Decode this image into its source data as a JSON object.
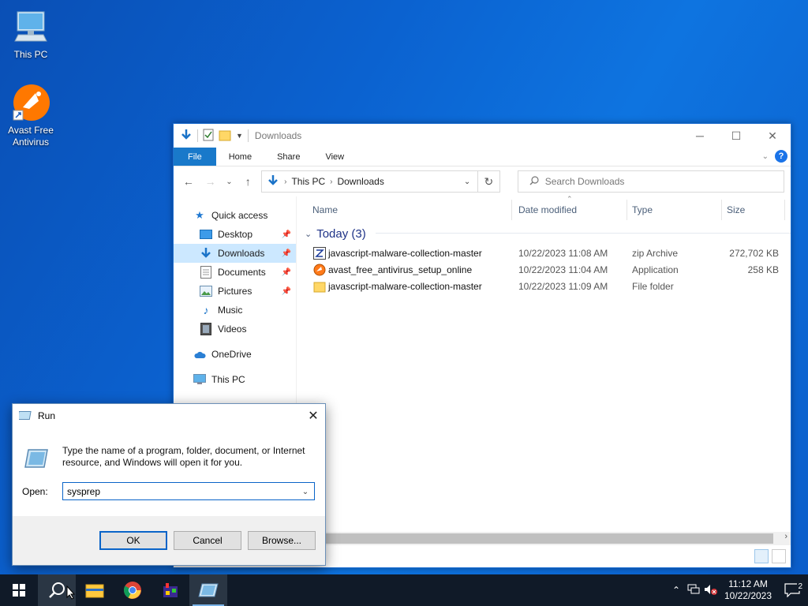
{
  "desktop": {
    "icons": [
      {
        "label": "This PC",
        "icon": "this-pc-icon"
      },
      {
        "label": "Avast Free Antivirus",
        "icon": "avast-icon"
      }
    ]
  },
  "explorer": {
    "title": "Downloads",
    "ribbon_tabs": [
      "File",
      "Home",
      "Share",
      "View"
    ],
    "address": [
      "This PC",
      "Downloads"
    ],
    "search_placeholder": "Search Downloads",
    "nav": {
      "quick_access": "Quick access",
      "items": [
        "Desktop",
        "Downloads",
        "Documents",
        "Pictures",
        "Music",
        "Videos"
      ],
      "onedrive": "OneDrive",
      "this_pc": "This PC"
    },
    "columns": [
      "Name",
      "Date modified",
      "Type",
      "Size"
    ],
    "group": "Today (3)",
    "files": [
      {
        "name": "javascript-malware-collection-master",
        "date": "10/22/2023 11:08 AM",
        "type": "zip Archive",
        "size": "272,702 KB",
        "icon": "zip-icon"
      },
      {
        "name": "avast_free_antivirus_setup_online",
        "date": "10/22/2023 11:04 AM",
        "type": "Application",
        "size": "258 KB",
        "icon": "avast-setup-icon"
      },
      {
        "name": "javascript-malware-collection-master",
        "date": "10/22/2023 11:09 AM",
        "type": "File folder",
        "size": "",
        "icon": "folder-icon"
      }
    ]
  },
  "run": {
    "title": "Run",
    "description": "Type the name of a program, folder, document, or Internet resource, and Windows will open it for you.",
    "open_label": "Open:",
    "open_value": "sysprep",
    "ok": "OK",
    "cancel": "Cancel",
    "browse": "Browse..."
  },
  "taskbar": {
    "time": "11:12 AM",
    "date": "10/22/2023",
    "notification_count": "2"
  },
  "colors": {
    "accent": "#1979ca",
    "taskbar": "#101a28",
    "desktop": "#0b62d0"
  }
}
